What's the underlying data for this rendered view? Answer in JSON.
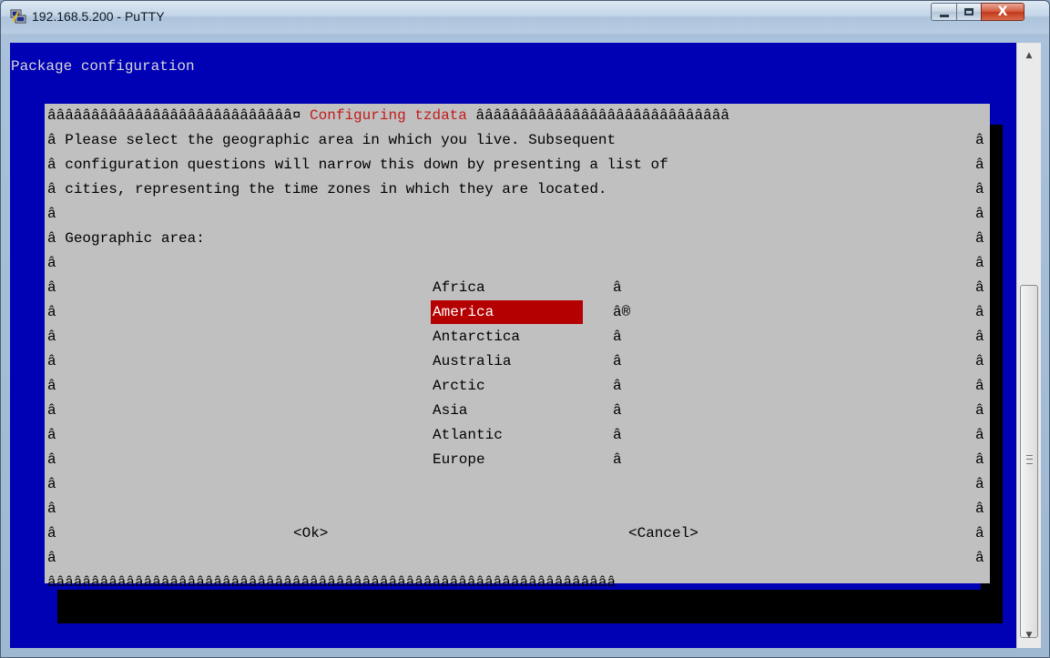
{
  "window": {
    "title": "192.168.5.200 - PuTTY",
    "close_label": "X"
  },
  "terminal": {
    "header": "Package configuration"
  },
  "dialog": {
    "top_border_left": "ââââââââââââââââââââââââââââ¤ ",
    "title": "Configuring tzdata",
    "top_border_right": " âââââââââââââââââââââââââââââ",
    "border_char": "â",
    "description": [
      "Please select the geographic area in which you live. Subsequent",
      "configuration questions will narrow this down by presenting a list of",
      "cities, representing the time zones in which they are located."
    ],
    "prompt": "Geographic area:",
    "areas": [
      "Africa",
      "America",
      "Antarctica",
      "Australia",
      "Arctic",
      "Asia",
      "Atlantic",
      "Europe"
    ],
    "selected_mark": "â®",
    "ok_label": "<Ok>",
    "cancel_label": "<Cancel>",
    "bottom_border": "âââââââââââââââââââââââââââââââââââââââââââââââââââââââââââââââââ"
  },
  "colors": {
    "terminal_bg": "#0000b4",
    "dialog_bg": "#c0c0c0",
    "selected_bg": "#b40000",
    "title_red": "#c41a1a"
  },
  "icons": {
    "app_icon": "putty-icon",
    "scroll_up": "triangle-up-icon",
    "scroll_down": "triangle-down-icon"
  }
}
